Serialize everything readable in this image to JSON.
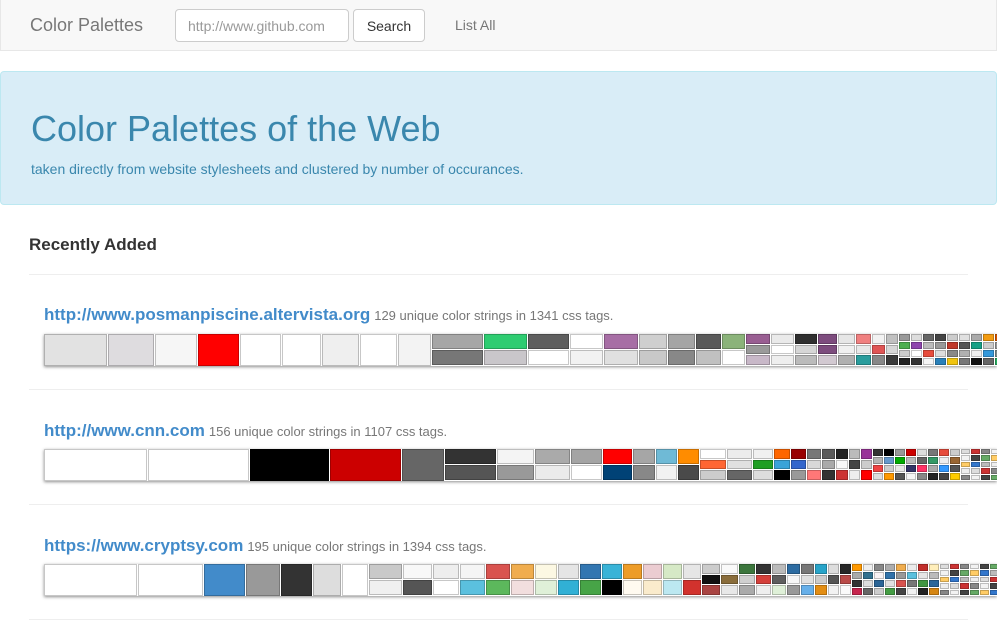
{
  "navbar": {
    "brand": "Color Palettes",
    "search_placeholder": "http://www.github.com",
    "search_button": "Search",
    "list_all": "List All"
  },
  "jumbotron": {
    "title": "Color Palettes of the Web",
    "subtitle": "taken directly from website stylesheets and clustered by number of occurances."
  },
  "recent": {
    "title": "Recently Added",
    "sites": [
      {
        "url": "http://www.posmanpiscine.altervista.org",
        "stats": "129 unique color strings in 1341 css tags.",
        "columns": [
          [
            "#e2e2e2"
          ],
          [
            "#dedcdf"
          ],
          [
            "#f6f6f6"
          ],
          [
            "#ff0000"
          ],
          [
            "#ffffff"
          ],
          [
            "#ffffff"
          ],
          [
            "#efefef"
          ],
          [
            "#ffffff"
          ],
          [
            "#f3f3f3"
          ],
          [
            "#a6a6a6",
            "#777777"
          ],
          [
            "#2ecc71",
            "#c9c6ca"
          ],
          [
            "#5e5e5e",
            "#ffffff"
          ],
          [
            "#ffffff",
            "#f2f2f2"
          ],
          [
            "#a76ea5",
            "#e0e0e0"
          ],
          [
            "#cfcfcf",
            "#c8c8c8"
          ],
          [
            "#a5a5a5",
            "#888888"
          ],
          [
            "#5a5a5a",
            "#c0c0c0"
          ],
          [
            "#8bb37a",
            "#ffffff"
          ],
          [
            "#995e92",
            "#9a9a9a",
            "#c8b8c8"
          ],
          [
            "#eaeaea",
            "#ffffff",
            "#eeeeee"
          ],
          [
            "#2f2f2f",
            "#d6d6d6",
            "#bbbbbb"
          ],
          [
            "#7d4c7e",
            "#7d4c7e",
            "#d2c9d1"
          ],
          [
            "#e6e6e6",
            "#f0f0f0",
            "#b0b0b0"
          ],
          [
            "#f08080",
            "#e8e8e8",
            "#2a9d9d"
          ],
          [
            "#f2f2f2",
            "#e05555",
            "#888888"
          ],
          [
            "#c0c0c0",
            "#d7d7d7",
            "#3a3a3a"
          ],
          [
            "#999999",
            "#4caf50",
            "#cccccc",
            "#222222"
          ],
          [
            "#dddddd",
            "#8e44ad",
            "#ffffff",
            "#333333"
          ],
          [
            "#666666",
            "#bbbbbb",
            "#e74c3c",
            "#f5f5f5"
          ],
          [
            "#444444",
            "#999999",
            "#dddddd",
            "#2980b9"
          ],
          [
            "#cccccc",
            "#c0392b",
            "#888888",
            "#f1c40f"
          ],
          [
            "#e0e0e0",
            "#555555",
            "#b0b0b0",
            "#777777"
          ],
          [
            "#aaaaaa",
            "#16a085",
            "#eeeeee",
            "#111111"
          ],
          [
            "#f39c12",
            "#cccccc",
            "#3498db",
            "#666666"
          ],
          [
            "#d35400",
            "#999999",
            "#7f8c8d",
            "#27ae60"
          ],
          [
            "#bdc3c7",
            "#e67e22",
            "#95a5a6",
            "#34495e"
          ]
        ]
      },
      {
        "url": "http://www.cnn.com",
        "stats": "156 unique color strings in 1107 css tags.",
        "columns": [
          [
            "#ffffff"
          ],
          [
            "#ffffff"
          ],
          [
            "#000000"
          ],
          [
            "#cc0000"
          ],
          [
            "#666666"
          ],
          [
            "#333333",
            "#555555"
          ],
          [
            "#f4f4f4",
            "#999999"
          ],
          [
            "#aaaaaa",
            "#ebebeb"
          ],
          [
            "#a4a4a4",
            "#ffffff"
          ],
          [
            "#ff0000",
            "#004276"
          ],
          [
            "#a6a6a6",
            "#888888"
          ],
          [
            "#6fbad6",
            "#f2f2f2"
          ],
          [
            "#ff8c00",
            "#4a4a4a"
          ],
          [
            "#ffffff",
            "#ff6633",
            "#cccccc"
          ],
          [
            "#ececec",
            "#e0e0e0",
            "#666666"
          ],
          [
            "#f0f0f0",
            "#1f9f23",
            "#dddddd"
          ],
          [
            "#ff6600",
            "#3aa3d8",
            "#000000"
          ],
          [
            "#990000",
            "#3366cc",
            "#999999"
          ],
          [
            "#777777",
            "#d8d8d8",
            "#ff7777"
          ],
          [
            "#5a5a5a",
            "#aaaaaa",
            "#333333"
          ],
          [
            "#222222",
            "#f8f8f8",
            "#cc3333"
          ],
          [
            "#bbbbbb",
            "#444444",
            "#eeeeee"
          ],
          [
            "#993399",
            "#cccccc",
            "#ff0000"
          ],
          [
            "#333333",
            "#b3b3b3",
            "#ee4444",
            "#dddddd"
          ],
          [
            "#000000",
            "#6699cc",
            "#cccccc",
            "#ff9900"
          ],
          [
            "#999999",
            "#00aa00",
            "#e8e8e8",
            "#555555"
          ],
          [
            "#cc0000",
            "#bbbbbb",
            "#333366",
            "#f5f5f5"
          ],
          [
            "#dddddd",
            "#666666",
            "#ff3366",
            "#888888"
          ],
          [
            "#777777",
            "#339966",
            "#aaaaaa",
            "#222222"
          ],
          [
            "#e74c3c",
            "#eeeeee",
            "#3399ff",
            "#444444"
          ],
          [
            "#cccccc",
            "#996633",
            "#555555",
            "#ffcc00"
          ]
        ]
      },
      {
        "url": "https://www.cryptsy.com",
        "stats": "195 unique color strings in 1394 css tags.",
        "columns": [
          [
            "#ffffff"
          ],
          [
            "#ffffff"
          ],
          [
            "#428bca"
          ],
          [
            "#999999"
          ],
          [
            "#333333"
          ],
          [
            "#dddddd"
          ],
          [
            "#ffffff"
          ],
          [
            "#c9c9c9",
            "#f0f0f0"
          ],
          [
            "#f8f8f8",
            "#555555"
          ],
          [
            "#eeeeee",
            "#ffffff"
          ],
          [
            "#f5f5f5",
            "#5bc0de"
          ],
          [
            "#d9534f",
            "#5cb85c"
          ],
          [
            "#f0ad4e",
            "#f2dede"
          ],
          [
            "#fcf8e3",
            "#dff0d8"
          ],
          [
            "#e5e5e5",
            "#31b0d5"
          ],
          [
            "#3276b1",
            "#47a447"
          ],
          [
            "#39b3d7",
            "#000000"
          ],
          [
            "#ed9c28",
            "#fffaf0"
          ],
          [
            "#ebccd1",
            "#faebcc"
          ],
          [
            "#d6e9c6",
            "#bce8f1"
          ],
          [
            "#e6e6e6",
            "#d2322d"
          ],
          [
            "#cccccc",
            "#111111",
            "#a94442"
          ],
          [
            "#f9f9f9",
            "#8a6d3b",
            "#e8e8e8"
          ],
          [
            "#3c763d",
            "#d0d0d0",
            "#aaaaaa"
          ],
          [
            "#333333",
            "#d43f3a",
            "#eeeeee"
          ],
          [
            "#bbbbbb",
            "#5e5e5e",
            "#dff0d8"
          ],
          [
            "#2d6ca2",
            "#f7f7f7",
            "#999999"
          ],
          [
            "#777777",
            "#e0e0e0",
            "#66afe9"
          ],
          [
            "#28a4c9",
            "#cccccc",
            "#e38d13"
          ],
          [
            "#dddddd",
            "#555555",
            "#f2f2f2"
          ],
          [
            "#262626",
            "#b94a48",
            "#fafafa"
          ],
          [
            "#ff9900",
            "#aaaaaa",
            "#333333",
            "#c7254e"
          ],
          [
            "#eeeeee",
            "#31708f",
            "#dddddd",
            "#666666"
          ],
          [
            "#888888",
            "#f9f2f4",
            "#2a6496",
            "#cccccc"
          ],
          [
            "#adadad",
            "#3071a9",
            "#e1e1e1",
            "#449d44"
          ],
          [
            "#f0ad4e",
            "#999999",
            "#d9534f",
            "#444444"
          ],
          [
            "#ebebeb",
            "#5bc0de",
            "#777777",
            "#f0f0f0"
          ],
          [
            "#c12e2a",
            "#e5e5e5",
            "#419641",
            "#222222"
          ],
          [
            "#ffeeba",
            "#bbbbbb",
            "#2b669a",
            "#d58512"
          ]
        ]
      }
    ]
  }
}
